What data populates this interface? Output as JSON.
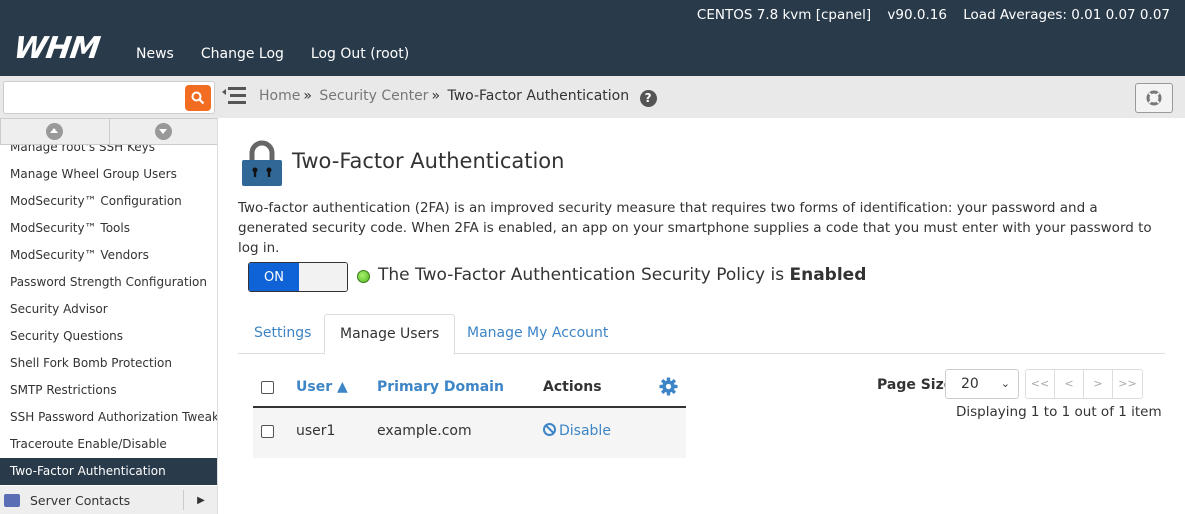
{
  "header": {
    "logo": "WHM",
    "nav": [
      "News",
      "Change Log",
      "Log Out (root)"
    ],
    "sysinfo": {
      "os": "CENTOS 7.8 kvm [cpanel]",
      "version": "v90.0.16",
      "load": "Load Averages: 0.01 0.07 0.07"
    }
  },
  "search": {
    "value": "",
    "placeholder": ""
  },
  "breadcrumb": {
    "items": [
      "Home",
      "Security Center",
      "Two-Factor Authentication"
    ],
    "separator": "»"
  },
  "sidebar": {
    "items": [
      "Manage root's SSH Keys",
      "Manage Wheel Group Users",
      "ModSecurity™ Configuration",
      "ModSecurity™ Tools",
      "ModSecurity™ Vendors",
      "Password Strength Configuration",
      "Security Advisor",
      "Security Questions",
      "Shell Fork Bomb Protection",
      "SMTP Restrictions",
      "SSH Password Authorization Tweak",
      "Traceroute Enable/Disable",
      "Two-Factor Authentication"
    ],
    "active_index": 12,
    "footer": "Server Contacts"
  },
  "page": {
    "title": "Two-Factor Authentication",
    "description": "Two-factor authentication (2FA) is an improved security measure that requires two forms of identification: your password and a generated security code. When 2FA is enabled, an app on your smartphone supplies a code that you must enter with your password to log in.",
    "toggle": {
      "label": "ON",
      "state": true
    },
    "status_prefix": "The Two-Factor Authentication Security Policy is ",
    "status_value": "Enabled",
    "status_color": "#5ac224"
  },
  "tabs": [
    {
      "label": "Settings",
      "active": false
    },
    {
      "label": "Manage Users",
      "active": true
    },
    {
      "label": "Manage My Account",
      "active": false
    }
  ],
  "table": {
    "columns": [
      "User ▲",
      "Primary Domain",
      "Actions"
    ],
    "rows": [
      {
        "user": "user1",
        "domain": "example.com",
        "action": "Disable"
      }
    ]
  },
  "pager": {
    "page_size_label": "Page Size",
    "page_size": "20",
    "buttons": [
      "<<",
      "<",
      ">",
      ">>"
    ],
    "info": "Displaying 1 to 1 out of 1 item"
  },
  "colors": {
    "header_bg": "#293a4a",
    "accent": "#3d85c6",
    "search_btn": "#f26c21",
    "toggle_on": "#0f63d6"
  }
}
